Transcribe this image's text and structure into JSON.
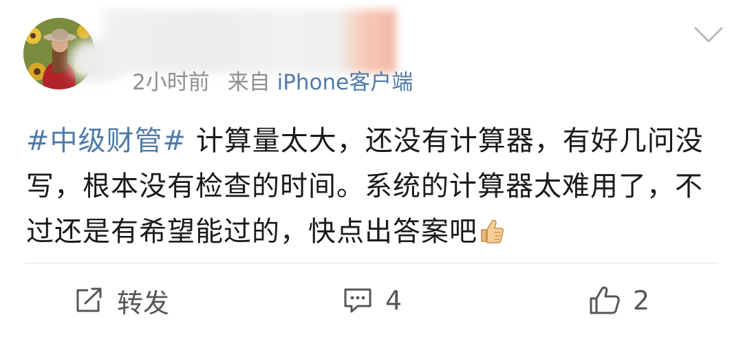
{
  "post": {
    "timestamp": "2小时前",
    "source_prefix": "来自",
    "source": "iPhone客户端",
    "topic": "#中级财管#",
    "text": " 计算量太大，还没有计算器，有好几问没写，根本没有检查的时间。系统的计算器太难用了，不过还是有希望能过的，快点出答案吧"
  },
  "actions": {
    "repost_label": "转发",
    "comment_count": "4",
    "like_count": "2"
  },
  "colors": {
    "link_blue": "#4f7baa",
    "meta_gray": "#8e8e8e",
    "action_gray": "#555555"
  },
  "icons": {
    "avatar": "user-avatar-photo",
    "menu": "chevron-down-icon",
    "repost": "repost-icon",
    "comment": "comment-icon",
    "like": "thumbs-up-icon",
    "emoji": "thumbs-up-emoji"
  }
}
